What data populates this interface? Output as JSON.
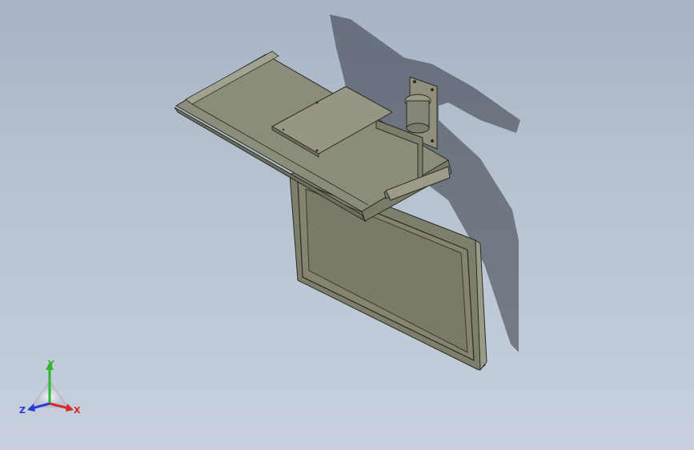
{
  "triad": {
    "x_label": "X",
    "y_label": "Y",
    "z_label": "Z",
    "x_color": "#d42a2a",
    "y_color": "#2fb52f",
    "z_color": "#2a3ad4"
  },
  "colors": {
    "background_top": "#a8b4c6",
    "background_bottom": "#c7d0dc",
    "model_face": "#8a8a78",
    "model_edge": "#2b2b24",
    "shadow": "#2a2f38"
  }
}
